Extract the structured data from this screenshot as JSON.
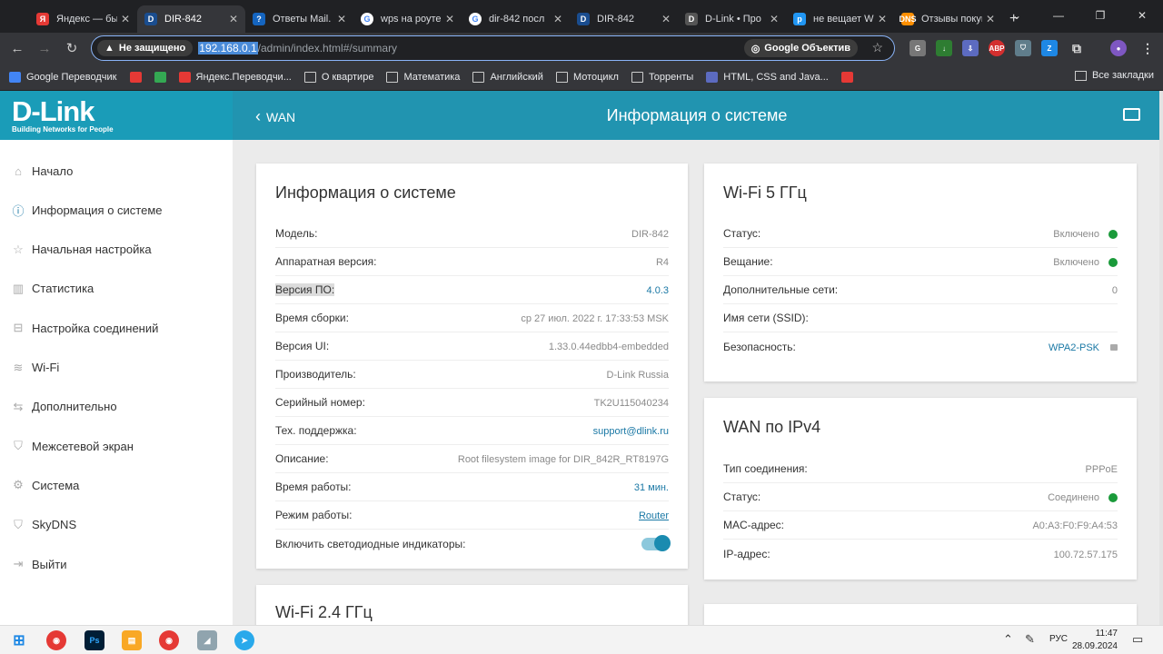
{
  "browser": {
    "tabs": [
      {
        "label": "Яндекс — бы",
        "color": "#e53935",
        "glyph": "Я"
      },
      {
        "label": "DIR-842",
        "color": "#1a4d8f",
        "glyph": "D",
        "active": true
      },
      {
        "label": "Ответы Mail.",
        "color": "#1565c0",
        "glyph": "?"
      },
      {
        "label": "wps на роуте",
        "color": "#ffffff",
        "glyph": "G"
      },
      {
        "label": "dir-842 посл",
        "color": "#ffffff",
        "glyph": "G"
      },
      {
        "label": "DIR-842",
        "color": "#1a4d8f",
        "glyph": "D"
      },
      {
        "label": "D-Link • Про",
        "color": "#555555",
        "glyph": "D"
      },
      {
        "label": "не вещает W",
        "color": "#2196f3",
        "glyph": "p"
      },
      {
        "label": "Отзывы покуп",
        "color": "#ff8f00",
        "glyph": "DNS"
      }
    ],
    "new_tab": "+",
    "insecure_label": "Не защищено",
    "url_host": "192.168.0.1",
    "url_path": "/admin/index.html#/summary",
    "lens_label": "Google Объектив",
    "bookmarks": [
      {
        "label": "Google Переводчик",
        "color": "#4285f4"
      },
      {
        "label": "",
        "color": "#e53935"
      },
      {
        "label": "",
        "color": "#34a853"
      },
      {
        "label": "Яндекс.Переводчи...",
        "color": "#e53935"
      },
      {
        "label": "О квартире",
        "folder": true
      },
      {
        "label": "Математика",
        "folder": true
      },
      {
        "label": "Английский",
        "folder": true
      },
      {
        "label": "Мотоцикл",
        "folder": true
      },
      {
        "label": "Торренты",
        "folder": true
      },
      {
        "label": "HTML, CSS and Java...",
        "color": "#5c6bc0"
      },
      {
        "label": "",
        "color": "#e53935"
      }
    ],
    "all_bookmarks": "Все закладки"
  },
  "header": {
    "logo": "D-Link",
    "logo_tagline": "Building Networks for People",
    "back_label": "WAN",
    "title": "Информация о системе"
  },
  "sidebar": {
    "items": [
      {
        "label": "Начало",
        "icon": "home-icon",
        "glyph": "⌂"
      },
      {
        "label": "Информация о системе",
        "icon": "info-icon",
        "glyph": "ⓘ",
        "active": true
      },
      {
        "label": "Начальная настройка",
        "icon": "wizard-icon",
        "glyph": "☆"
      },
      {
        "label": "Статистика",
        "icon": "chart-icon",
        "glyph": "▥"
      },
      {
        "label": "Настройка соединений",
        "icon": "connections-icon",
        "glyph": "⊟"
      },
      {
        "label": "Wi-Fi",
        "icon": "wifi-icon",
        "glyph": "≋"
      },
      {
        "label": "Дополнительно",
        "icon": "advanced-icon",
        "glyph": "⇆"
      },
      {
        "label": "Межсетевой экран",
        "icon": "shield-icon",
        "glyph": "⛉"
      },
      {
        "label": "Система",
        "icon": "gear-icon",
        "glyph": "⚙"
      },
      {
        "label": "SkyDNS",
        "icon": "skydns-icon",
        "glyph": "⛉"
      },
      {
        "label": "Выйти",
        "icon": "logout-icon",
        "glyph": "⇥"
      }
    ]
  },
  "system_info": {
    "title": "Информация о системе",
    "rows": [
      {
        "label": "Модель:",
        "value": "DIR-842"
      },
      {
        "label": "Аппаратная версия:",
        "value": "R4"
      },
      {
        "label": "Версия ПО:",
        "value": "4.0.3",
        "link": true
      },
      {
        "label": "Время сборки:",
        "value": "ср 27 июл. 2022 г. 17:33:53 MSK"
      },
      {
        "label": "Версия UI:",
        "value": "1.33.0.44edbb4-embedded"
      },
      {
        "label": "Производитель:",
        "value": "D-Link Russia"
      },
      {
        "label": "Серийный номер:",
        "value": "TK2U115040234"
      },
      {
        "label": "Тех. поддержка:",
        "value": "support@dlink.ru",
        "link": true
      },
      {
        "label": "Описание:",
        "value": "Root filesystem image for DIR_842R_RT8197G"
      },
      {
        "label": "Время работы:",
        "value": "31 мин.",
        "link": true
      },
      {
        "label": "Режим работы:",
        "value": "Router",
        "link": true,
        "underline": true
      },
      {
        "label": "Включить светодиодные индикаторы:",
        "toggle": true
      }
    ]
  },
  "wifi5": {
    "title": "Wi-Fi 5 ГГц",
    "rows": [
      {
        "label": "Статус:",
        "value": "Включено",
        "dot": true
      },
      {
        "label": "Вещание:",
        "value": "Включено",
        "dot": true
      },
      {
        "label": "Дополнительные сети:",
        "value": "0"
      },
      {
        "label": "Имя сети (SSID):",
        "value": ""
      },
      {
        "label": "Безопасность:",
        "value": "WPA2-PSK",
        "link": true,
        "lock": true
      }
    ]
  },
  "wan": {
    "title": "WAN по IPv4",
    "rows": [
      {
        "label": "Тип соединения:",
        "value": "PPPoE"
      },
      {
        "label": "Статус:",
        "value": "Соединено",
        "dot": true
      },
      {
        "label": "MAC-адрес:",
        "value": "A0:A3:F0:F9:A4:53"
      },
      {
        "label": "IP-адрес:",
        "value": "100.72.57.175"
      }
    ]
  },
  "wifi24": {
    "title": "Wi-Fi 2.4 ГГц"
  },
  "taskbar": {
    "lang": "РУС",
    "time": "11:47",
    "date": "28.09.2024"
  },
  "colors": {
    "brand": "#1a9cb8",
    "status_ok": "#1a9a3a",
    "link": "#1a78a5"
  }
}
